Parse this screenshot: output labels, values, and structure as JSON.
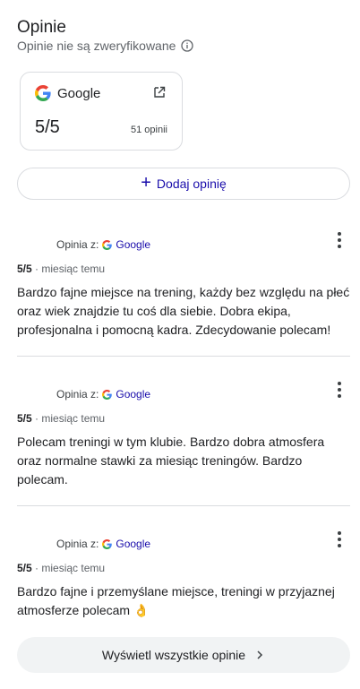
{
  "header": {
    "title": "Opinie",
    "subtitle": "Opinie nie są zweryfikowane"
  },
  "source_card": {
    "name": "Google",
    "score": "5/5",
    "count": "51 opinii"
  },
  "add_review": {
    "label": "Dodaj opinię"
  },
  "reviews": [
    {
      "source_prefix": "Opinia z:",
      "source_name": "Google",
      "rating": "5/5",
      "time": " · miesiąc temu",
      "text": "Bardzo fajne miejsce na trening, każdy bez względu na płeć oraz wiek znajdzie tu coś dla siebie. Dobra ekipa, profesjonalna i pomocną kadra. Zdecydowanie polecam!"
    },
    {
      "source_prefix": "Opinia z:",
      "source_name": "Google",
      "rating": "5/5",
      "time": " · miesiąc temu",
      "text": "Polecam treningi w tym klubie. Bardzo dobra atmosfera oraz normalne stawki za miesiąc treningów. Bardzo polecam."
    },
    {
      "source_prefix": "Opinia z:",
      "source_name": "Google",
      "rating": "5/5",
      "time": " · miesiąc temu",
      "text": "Bardzo fajne i przemyślane miejsce, treningi w przyjaznej atmosferze polecam 👌"
    }
  ],
  "show_all": {
    "label": "Wyświetl wszystkie opinie"
  },
  "colors": {
    "link": "#1a0dab",
    "border": "#dadce0",
    "muted": "#5f6368",
    "button_bg": "#f1f3f4"
  },
  "icons": [
    "info-icon",
    "google-logo-icon",
    "external-link-icon",
    "plus-icon",
    "more-vert-icon",
    "chevron-right-icon"
  ]
}
